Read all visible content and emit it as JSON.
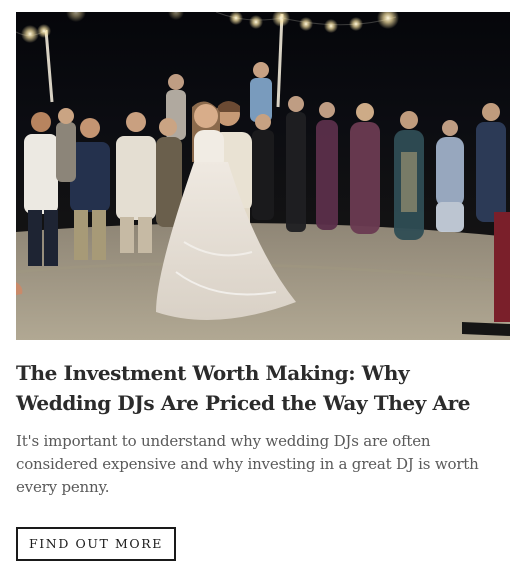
{
  "article": {
    "image_alt": "Bride and groom sharing a first dance under string lights surrounded by wedding guests",
    "title": "The Investment Worth Making: Why Wedding DJs Are Priced the Way They Are",
    "excerpt": "It's important to understand why wedding DJs are often considered expensive and why investing in a great DJ is worth every penny.",
    "cta_label": "FIND OUT MORE"
  }
}
